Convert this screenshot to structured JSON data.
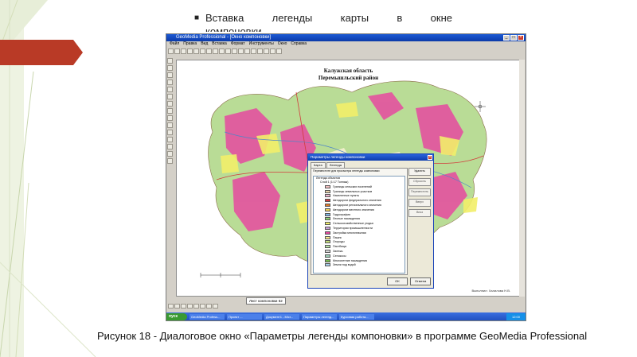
{
  "slide": {
    "bullet_text": "Вставка легенды карты в окне компоновки",
    "bullet_line1": "Вставка легенды карты в окне",
    "bullet_line2": "компоновки",
    "caption": "Рисунок 18 - Диалоговое окно «Параметры легенды компоновки» в программе GeoMedia Professional"
  },
  "window": {
    "title": "GeoMedia Professional - [Окно компоновки]",
    "menu": [
      "Файл",
      "Правка",
      "Вид",
      "Вставка",
      "Формат",
      "Инструменты",
      "Окно",
      "Справка"
    ],
    "map_title_line1": "Калужская область",
    "map_title_line2": "Перемышльский район",
    "author_note": "Выполнил: Халилова Н.В.",
    "sheet_tab": "Лист компоновки 62",
    "start_label": "пуск",
    "taskbar_items": [
      "GeoMedia Profess...",
      "Проект ...",
      "Документ1 - Micr...",
      "Параметры легенд...",
      "Курсовая работа..."
    ],
    "tray_time": "12:00"
  },
  "dialog": {
    "title": "Параметры легенды компоновки",
    "tabs": [
      "Карта",
      "Легенда"
    ],
    "inner_label": "Переместите для просмотра легенды компоновки",
    "tree_root": "Легенда объектов",
    "tree_sub": "Слой 1 (1:17 Тоннаж)",
    "legend_items": [
      {
        "label": "Границы сельских поселений",
        "color": "#f3c0c0"
      },
      {
        "label": "Границы земельных участков",
        "color": "#e8d2a8"
      },
      {
        "label": "Населенные пункты",
        "color": "#f0b8d0"
      },
      {
        "label": "Автодороги федерального значения",
        "color": "#d23c3c"
      },
      {
        "label": "Автодороги регионального значения",
        "color": "#e07a2a"
      },
      {
        "label": "Автодороги местного значения",
        "color": "#f4d15a"
      },
      {
        "label": "Гидрография",
        "color": "#7fb6e6"
      },
      {
        "label": "Лесные насаждения",
        "color": "#8ed474"
      },
      {
        "label": "Сельскохозяйственные угодья",
        "color": "#f2ef6a"
      },
      {
        "label": "Территории промышленности",
        "color": "#c7a0d8"
      },
      {
        "label": "Застройка многоэтажная",
        "color": "#e64aa0"
      },
      {
        "label": "Пашни",
        "color": "#f9e88a"
      },
      {
        "label": "Огороды",
        "color": "#c6e07a"
      },
      {
        "label": "Пастбища",
        "color": "#b8e4a8"
      },
      {
        "label": "Залежь",
        "color": "#d6d6d6"
      },
      {
        "label": "Сенокосы",
        "color": "#9dd2b8"
      },
      {
        "label": "Многолетние насаждения",
        "color": "#76b84c"
      },
      {
        "label": "Земли под водой",
        "color": "#a9d0ee"
      }
    ],
    "side_buttons": [
      "Удалить",
      "Сбросить",
      "Переместить",
      "Вверх",
      "Вниз"
    ],
    "ok_label": "OK",
    "cancel_label": "Отмена"
  },
  "colors": {
    "map_pink": "#e64aa0",
    "map_yellow": "#f2ef6a",
    "map_green": "#9ccf7a",
    "accent_red": "#b93a26"
  }
}
